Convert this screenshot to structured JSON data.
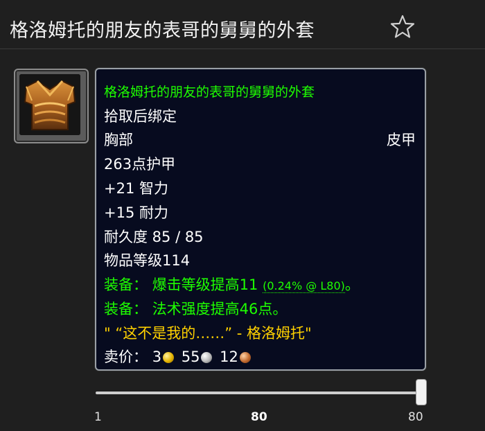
{
  "header": {
    "title": "格洛姆托的朋友的表哥的舅舅的外套"
  },
  "tooltip": {
    "name": "格洛姆托的朋友的表哥的舅舅的外套",
    "binding": "拾取后绑定",
    "slot": "胸部",
    "armor_type": "皮甲",
    "armor": "263点护甲",
    "stat_int": "+21 智力",
    "stat_sta": "+15 耐力",
    "durability": "耐久度 85 / 85",
    "item_level": "物品等级114",
    "equip1_prefix": "装备：",
    "equip1_text": "爆击等级提高11",
    "equip1_rating": "(0.24% @ L80)",
    "equip1_suffix": "。",
    "equip2_prefix": "装备：",
    "equip2_text": "法术强度提高46点。",
    "flavor": "\" “这不是我的……” - 格洛姆托\"",
    "sell_label": "卖价：",
    "sell_gold": "3",
    "sell_silver": "55",
    "sell_copper": "12"
  },
  "slider": {
    "min_label": "1",
    "current_label": "80",
    "max_label": "80",
    "level": 80,
    "min": 1,
    "max": 80
  },
  "colors": {
    "quality_green": "#1eff00",
    "flavor_yellow": "#ffd100",
    "tooltip_bg": "#070b1f"
  },
  "icons": {
    "favorite": "star-outline-icon",
    "item": "leather-chest-armor-icon"
  }
}
